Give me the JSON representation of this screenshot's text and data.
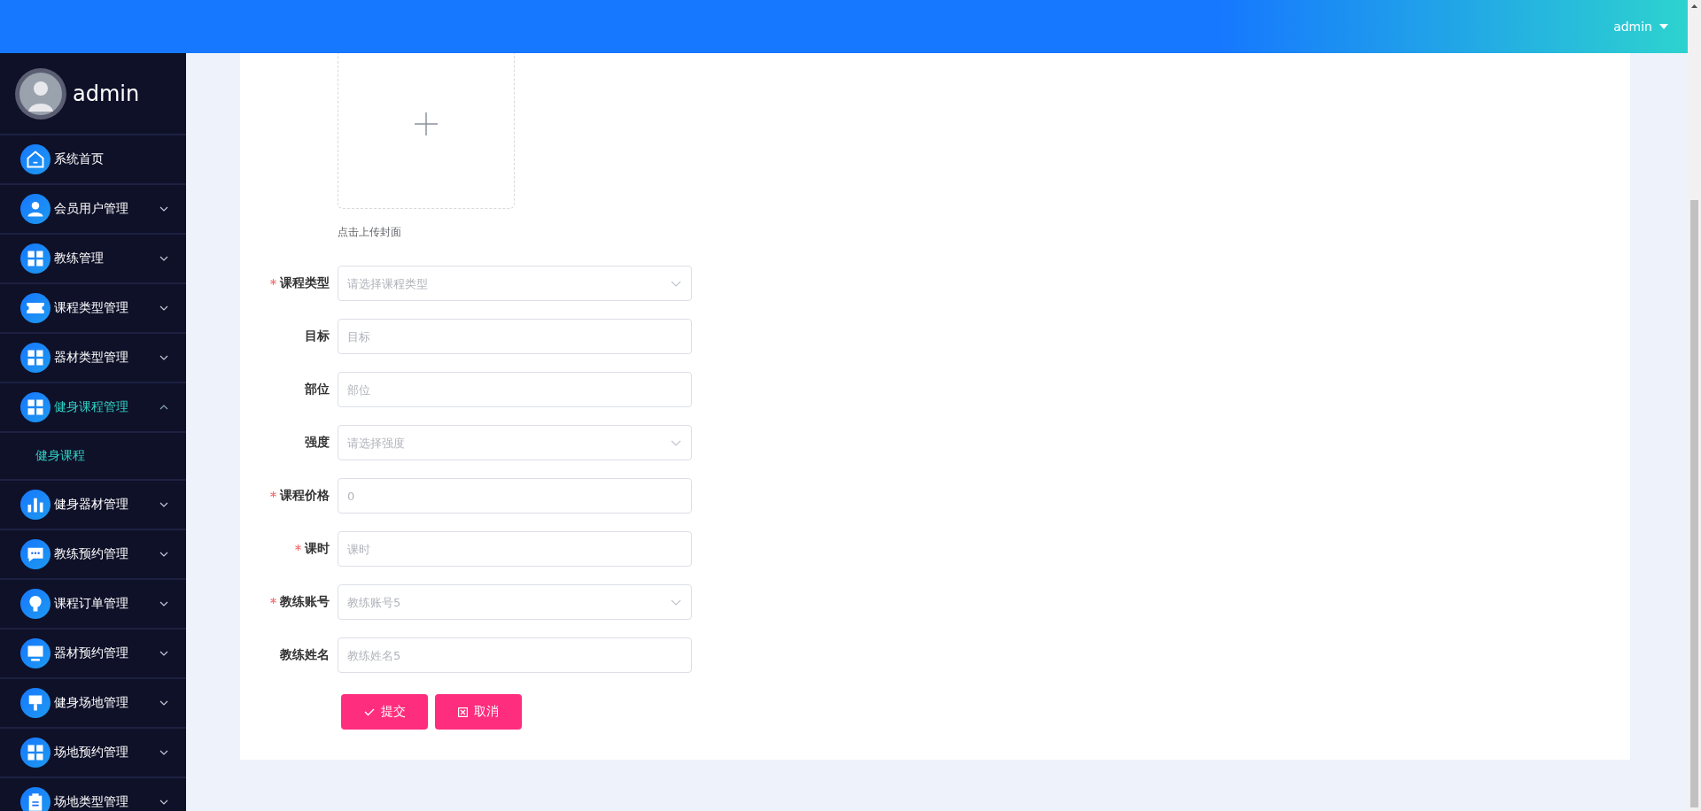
{
  "header": {
    "user": "admin"
  },
  "sidebar": {
    "user": "admin",
    "items": [
      {
        "label": "系统首页"
      },
      {
        "label": "会员用户管理",
        "expanded": false
      },
      {
        "label": "教练管理",
        "expanded": false
      },
      {
        "label": "课程类型管理",
        "expanded": false
      },
      {
        "label": "器材类型管理",
        "expanded": false
      },
      {
        "label": "健身课程管理",
        "expanded": true,
        "children": [
          {
            "label": "健身课程",
            "selected": true
          }
        ]
      },
      {
        "label": "健身器材管理",
        "expanded": false
      },
      {
        "label": "教练预约管理",
        "expanded": false
      },
      {
        "label": "课程订单管理",
        "expanded": false
      },
      {
        "label": "器材预约管理",
        "expanded": false
      },
      {
        "label": "健身场地管理",
        "expanded": false
      },
      {
        "label": "场地预约管理",
        "expanded": false
      },
      {
        "label": "场地类型管理",
        "expanded": false
      }
    ]
  },
  "form": {
    "upload": {
      "hint": "点击上传封面"
    },
    "fields": [
      {
        "label": "课程类型",
        "required": true,
        "kind": "select",
        "placeholder": "请选择课程类型"
      },
      {
        "label": "目标",
        "required": false,
        "kind": "input",
        "placeholder": "目标"
      },
      {
        "label": "部位",
        "required": false,
        "kind": "input",
        "placeholder": "部位"
      },
      {
        "label": "强度",
        "required": false,
        "kind": "select",
        "placeholder": "请选择强度"
      },
      {
        "label": "课程价格",
        "required": true,
        "kind": "input",
        "placeholder": "0"
      },
      {
        "label": "课时",
        "required": true,
        "kind": "input",
        "placeholder": "课时"
      },
      {
        "label": "教练账号",
        "required": true,
        "kind": "select",
        "placeholder": "教练账号5"
      },
      {
        "label": "教练姓名",
        "required": false,
        "kind": "input",
        "placeholder": "教练姓名5"
      }
    ],
    "buttons": [
      {
        "label": "提交",
        "kind": "submit"
      },
      {
        "label": "取消",
        "kind": "cancel"
      }
    ]
  }
}
